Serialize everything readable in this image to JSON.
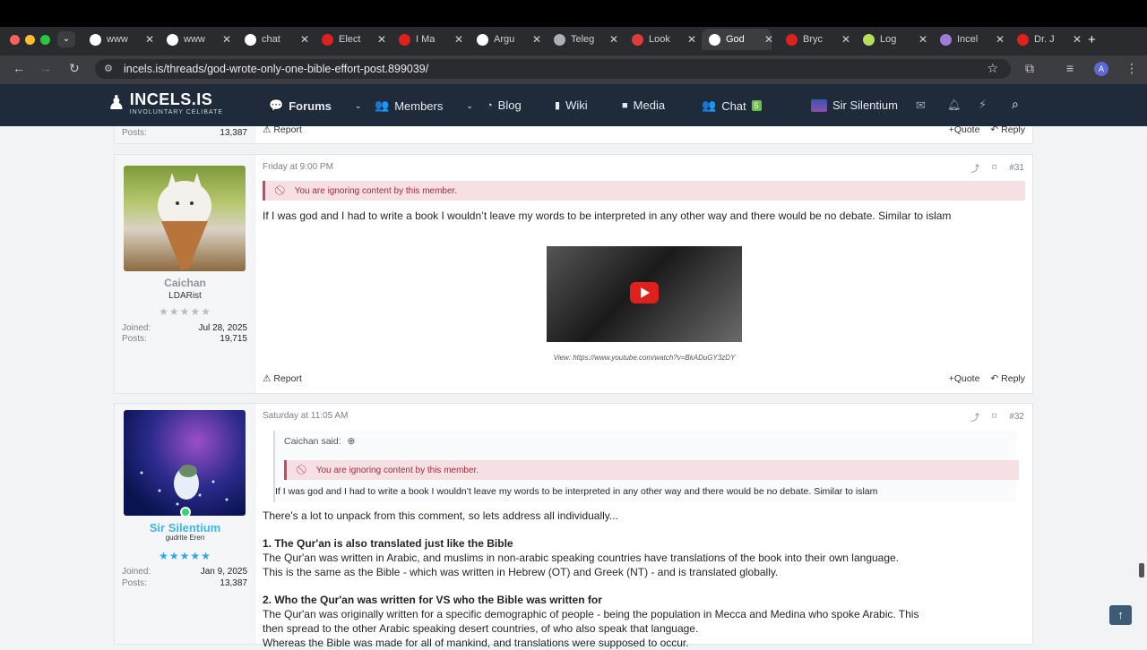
{
  "browser": {
    "tabs": [
      {
        "label": "www",
        "icon": "google-icon",
        "color": "#ffffff"
      },
      {
        "label": "www",
        "icon": "google-icon",
        "color": "#ffffff"
      },
      {
        "label": "chat",
        "icon": "chatgpt-icon",
        "color": "#ffffff"
      },
      {
        "label": "Elect",
        "icon": "youtube-icon",
        "color": "#e0201a"
      },
      {
        "label": "I Ma",
        "icon": "youtube-icon",
        "color": "#e0201a"
      },
      {
        "label": "Argu",
        "icon": "chatgpt-icon",
        "color": "#ffffff"
      },
      {
        "label": "Teleg",
        "icon": "globe-icon",
        "color": "#aab0b8"
      },
      {
        "label": "Look",
        "icon": "bookmark-icon",
        "color": "#e03a3a"
      },
      {
        "label": "God",
        "icon": "incels-icon",
        "color": "#ffffff",
        "active": true
      },
      {
        "label": "Bryc",
        "icon": "youtube-icon",
        "color": "#e0201a"
      },
      {
        "label": "Log",
        "icon": "leaf-icon",
        "color": "#b6e05a"
      },
      {
        "label": "Incel",
        "icon": "incels-icon",
        "color": "#a07bd8"
      },
      {
        "label": "Dr. J",
        "icon": "youtube-icon",
        "color": "#e0201a"
      }
    ],
    "url": "incels.is/threads/god-wrote-only-one-bible-effort-post.899039/"
  },
  "site": {
    "logo_main": "INCELS.IS",
    "logo_sub": "INVOLUNTARY CELIBATE",
    "nav": {
      "forums": "Forums",
      "members": "Members",
      "blog": "Blog",
      "wiki": "Wiki",
      "media": "Media",
      "chat": "Chat",
      "chat_count": "5",
      "user": "Sir Silentium"
    }
  },
  "prev_post": {
    "posts_label": "Posts:",
    "posts_value": "13,387",
    "report": "Report",
    "quote": "Quote",
    "reply": "Reply"
  },
  "post31": {
    "timestamp": "Friday at 9:00 PM",
    "number": "#31",
    "ignored_text": "You are ignoring content by this member.",
    "body": "If I was god and I had to write a book I wouldn’t leave my words to be interpreted in any other way and there would be no debate. Similar to islam",
    "video_caption": "View: https://www.youtube.com/watch?v=BkADuGY3zDY",
    "user": {
      "name": "Caichan",
      "title": "LDARist",
      "stars": "★★★★★",
      "joined_label": "Joined:",
      "joined": "Jul 28, 2025",
      "posts_label": "Posts:",
      "posts": "19,715"
    },
    "report": "Report",
    "quote": "Quote",
    "reply": "Reply"
  },
  "post32": {
    "timestamp": "Saturday at 11:05 AM",
    "number": "#32",
    "quote_author": "Caichan said:",
    "ignored_text": "You are ignoring content by this member.",
    "quote_body": "If I was god and I had to write a book I wouldn’t leave my words to be interpreted in any other way and there would be no debate. Similar to islam",
    "intro": "There's a lot to unpack from this comment, so lets address all individually...",
    "h1": "1. The Qur'an is also translated just like the Bible",
    "p1a": "The Qur'an was written in Arabic, and muslims in non-arabic speaking countries have translations of the book into their own language.",
    "p1b": "This is the same as the Bible - which was written in Hebrew (OT) and Greek (NT) - and is translated globally.",
    "h2": "2. Who the Qur'an was written for VS who the Bible was written for",
    "p2a": "The Qur'an was originally written for a specific demographic of people - being the population in Mecca and Medina who spoke Arabic. This",
    "p2b": "then spread to the other Arabic speaking desert countries, of who also speak that language.",
    "p2c": "Whereas the Bible was made for all of mankind, and translations were supposed to occur.",
    "user": {
      "name": "Sir Silentium",
      "title": "gudrite Eren",
      "stars": "★★★★★",
      "joined_label": "Joined:",
      "joined": "Jan 9, 2025",
      "posts_label": "Posts:",
      "posts": "13,387"
    }
  }
}
